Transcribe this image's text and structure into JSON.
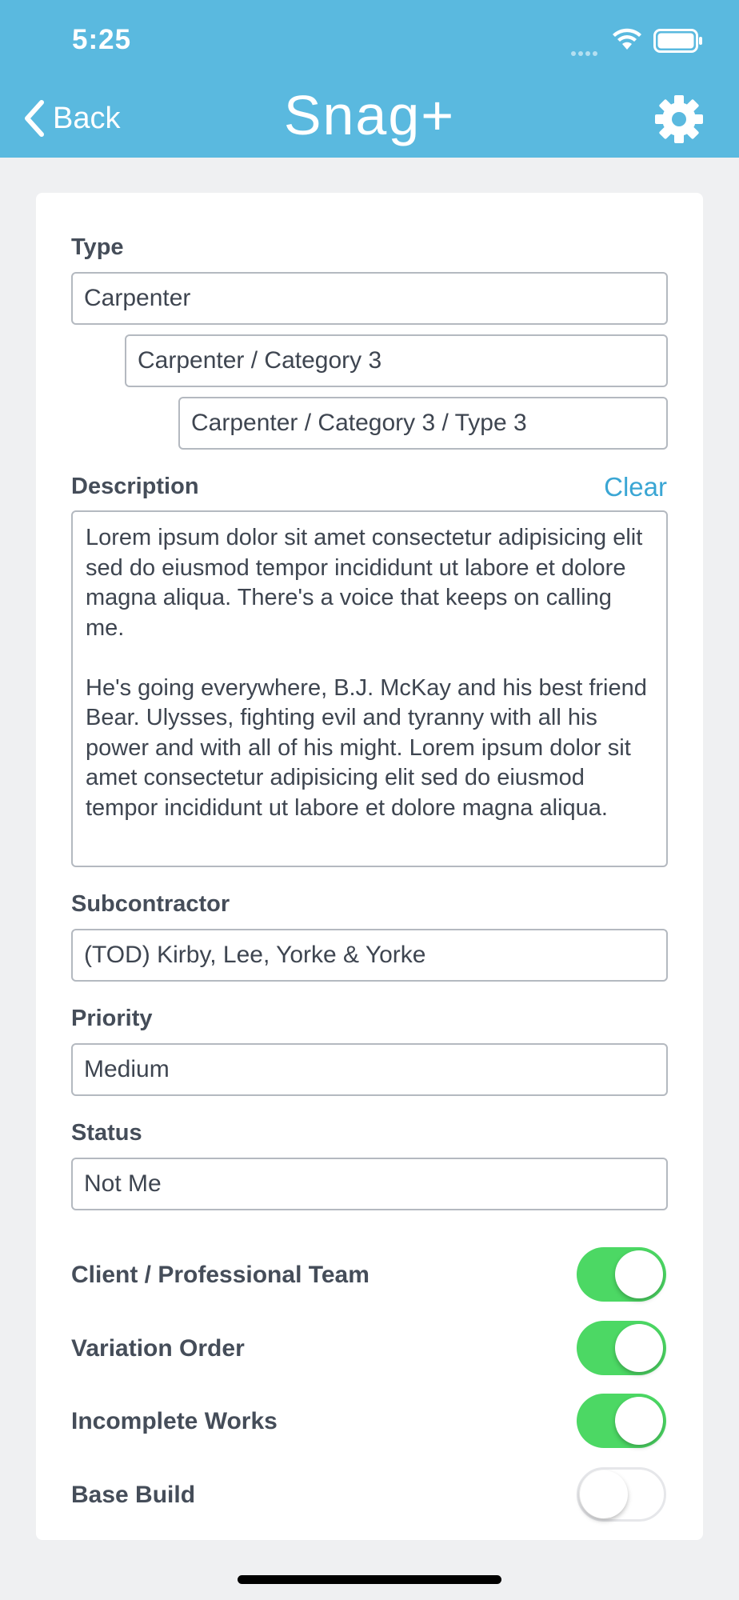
{
  "status_bar": {
    "time": "5:25"
  },
  "nav": {
    "back_label": "Back",
    "title": "Snag+"
  },
  "form": {
    "type": {
      "label": "Type",
      "levels": [
        "Carpenter",
        "Carpenter / Category 3",
        "Carpenter / Category 3 / Type 3"
      ]
    },
    "description": {
      "label": "Description",
      "clear_label": "Clear",
      "paragraphs": [
        "Lorem ipsum dolor sit amet  consectetur adipisicing elit sed do eiusmod tempor incididunt ut labore et dolore magna aliqua. There's a voice that keeps on calling me.",
        "He's going everywhere, B.J. McKay and his best friend Bear. Ulysses, fighting evil and tyranny with all his power and with all of his might. Lorem ipsum dolor sit amet  consectetur adipisicing elit sed do eiusmod tempor incididunt ut labore et dolore magna aliqua."
      ]
    },
    "subcontractor": {
      "label": "Subcontractor",
      "value": "(TOD) Kirby, Lee, Yorke & Yorke"
    },
    "priority": {
      "label": "Priority",
      "value": "Medium"
    },
    "status": {
      "label": "Status",
      "value": "Not Me"
    },
    "toggles": [
      {
        "label": "Client / Professional Team",
        "on": true
      },
      {
        "label": "Variation Order",
        "on": true
      },
      {
        "label": "Incomplete Works",
        "on": true
      },
      {
        "label": "Base Build",
        "on": false
      }
    ]
  },
  "colors": {
    "header": "#5ab9df",
    "toggle_on": "#4cd864",
    "link": "#3aa6d4"
  }
}
